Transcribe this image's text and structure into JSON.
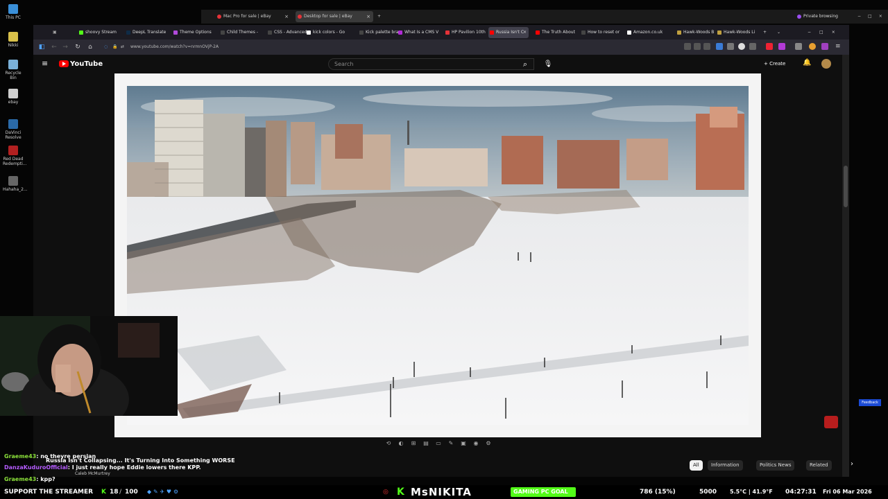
{
  "desktop": {
    "icons": [
      {
        "label": "This PC",
        "color": "#3a8fd8"
      },
      {
        "label": "Nikki",
        "color": "#d8c04a"
      },
      {
        "label": "Recycle Bin",
        "color": "#7ab0d8"
      },
      {
        "label": "ebay",
        "color": "#cfcfcf"
      },
      {
        "label": "DaVinci Resolve",
        "color": "#2a6aa8"
      },
      {
        "label": "Red Dead Redempti...",
        "color": "#b22020"
      },
      {
        "label": "Hahaha_2...",
        "color": "#666666"
      }
    ]
  },
  "back_window": {
    "tabs": [
      {
        "label": "Mac Pro for sale | eBay",
        "color": "#e53238"
      },
      {
        "label": "Desktop for sale | eBay",
        "color": "#e53238"
      }
    ],
    "private_label": "Private browsing"
  },
  "browser": {
    "tabs": [
      {
        "label": "shoovy Stream",
        "color": "#53fc18"
      },
      {
        "label": "DeepL Translate",
        "color": "#0f2b46"
      },
      {
        "label": "Theme Options",
        "color": "#b14adb"
      },
      {
        "label": "Child Themes -",
        "color": "#444444"
      },
      {
        "label": "CSS - Advanced",
        "color": "#444444"
      },
      {
        "label": "kick colors - Go",
        "color": "#ffffff"
      },
      {
        "label": "Kick palette bra",
        "color": "#444444"
      },
      {
        "label": "What Is a CMS V",
        "color": "#b12ad6"
      },
      {
        "label": "HP Pavilion 10th",
        "color": "#e53238"
      },
      {
        "label": "Russia Isn't C",
        "color": "#ff0000"
      },
      {
        "label": "The Truth About",
        "color": "#ff0000"
      },
      {
        "label": "How to reset or",
        "color": "#444444"
      },
      {
        "label": "Amazon.co.uk",
        "color": "#ffffff"
      },
      {
        "label": "Hawk-Woods B",
        "color": "#c0a040"
      },
      {
        "label": "Hawk-Woods Li",
        "color": "#c0a040"
      }
    ],
    "url": "www.youtube.com/watch?v=nrmnOVjP-2A"
  },
  "youtube": {
    "logo_text": "YouTube",
    "search_placeholder": "Search",
    "create_label": "Create",
    "chips": [
      "All",
      "Information",
      "Politics News",
      "Related"
    ]
  },
  "chat": {
    "lines": [
      {
        "user": "Graeme43",
        "message": ": no theyre persian"
      },
      {
        "user": "DanzaKuduroOfficial",
        "message": ": I just really hope Eddie lowers there KPP."
      },
      {
        "user": "Graeme43",
        "message": ": kpp?"
      }
    ],
    "video_title": "Russia Isn't Collapsing... It's Turning Into Something WORSE",
    "channel": "Caleb McMurtrey"
  },
  "streambar": {
    "support_text": "SUPPORT THE STREAMER",
    "count_a": "18",
    "count_b": "100",
    "streamer_name": "MsNIKITA",
    "goal_label": "GAMING PC GOAL",
    "goal_progress": "786 (15%)",
    "goal_progress_percent": 15,
    "goal_target": "5000",
    "weather": "5.5°C | 41.9°F",
    "time": "04:27:31",
    "date": "Fri 06 Mar 2026"
  },
  "feedback_label": "Feedback"
}
